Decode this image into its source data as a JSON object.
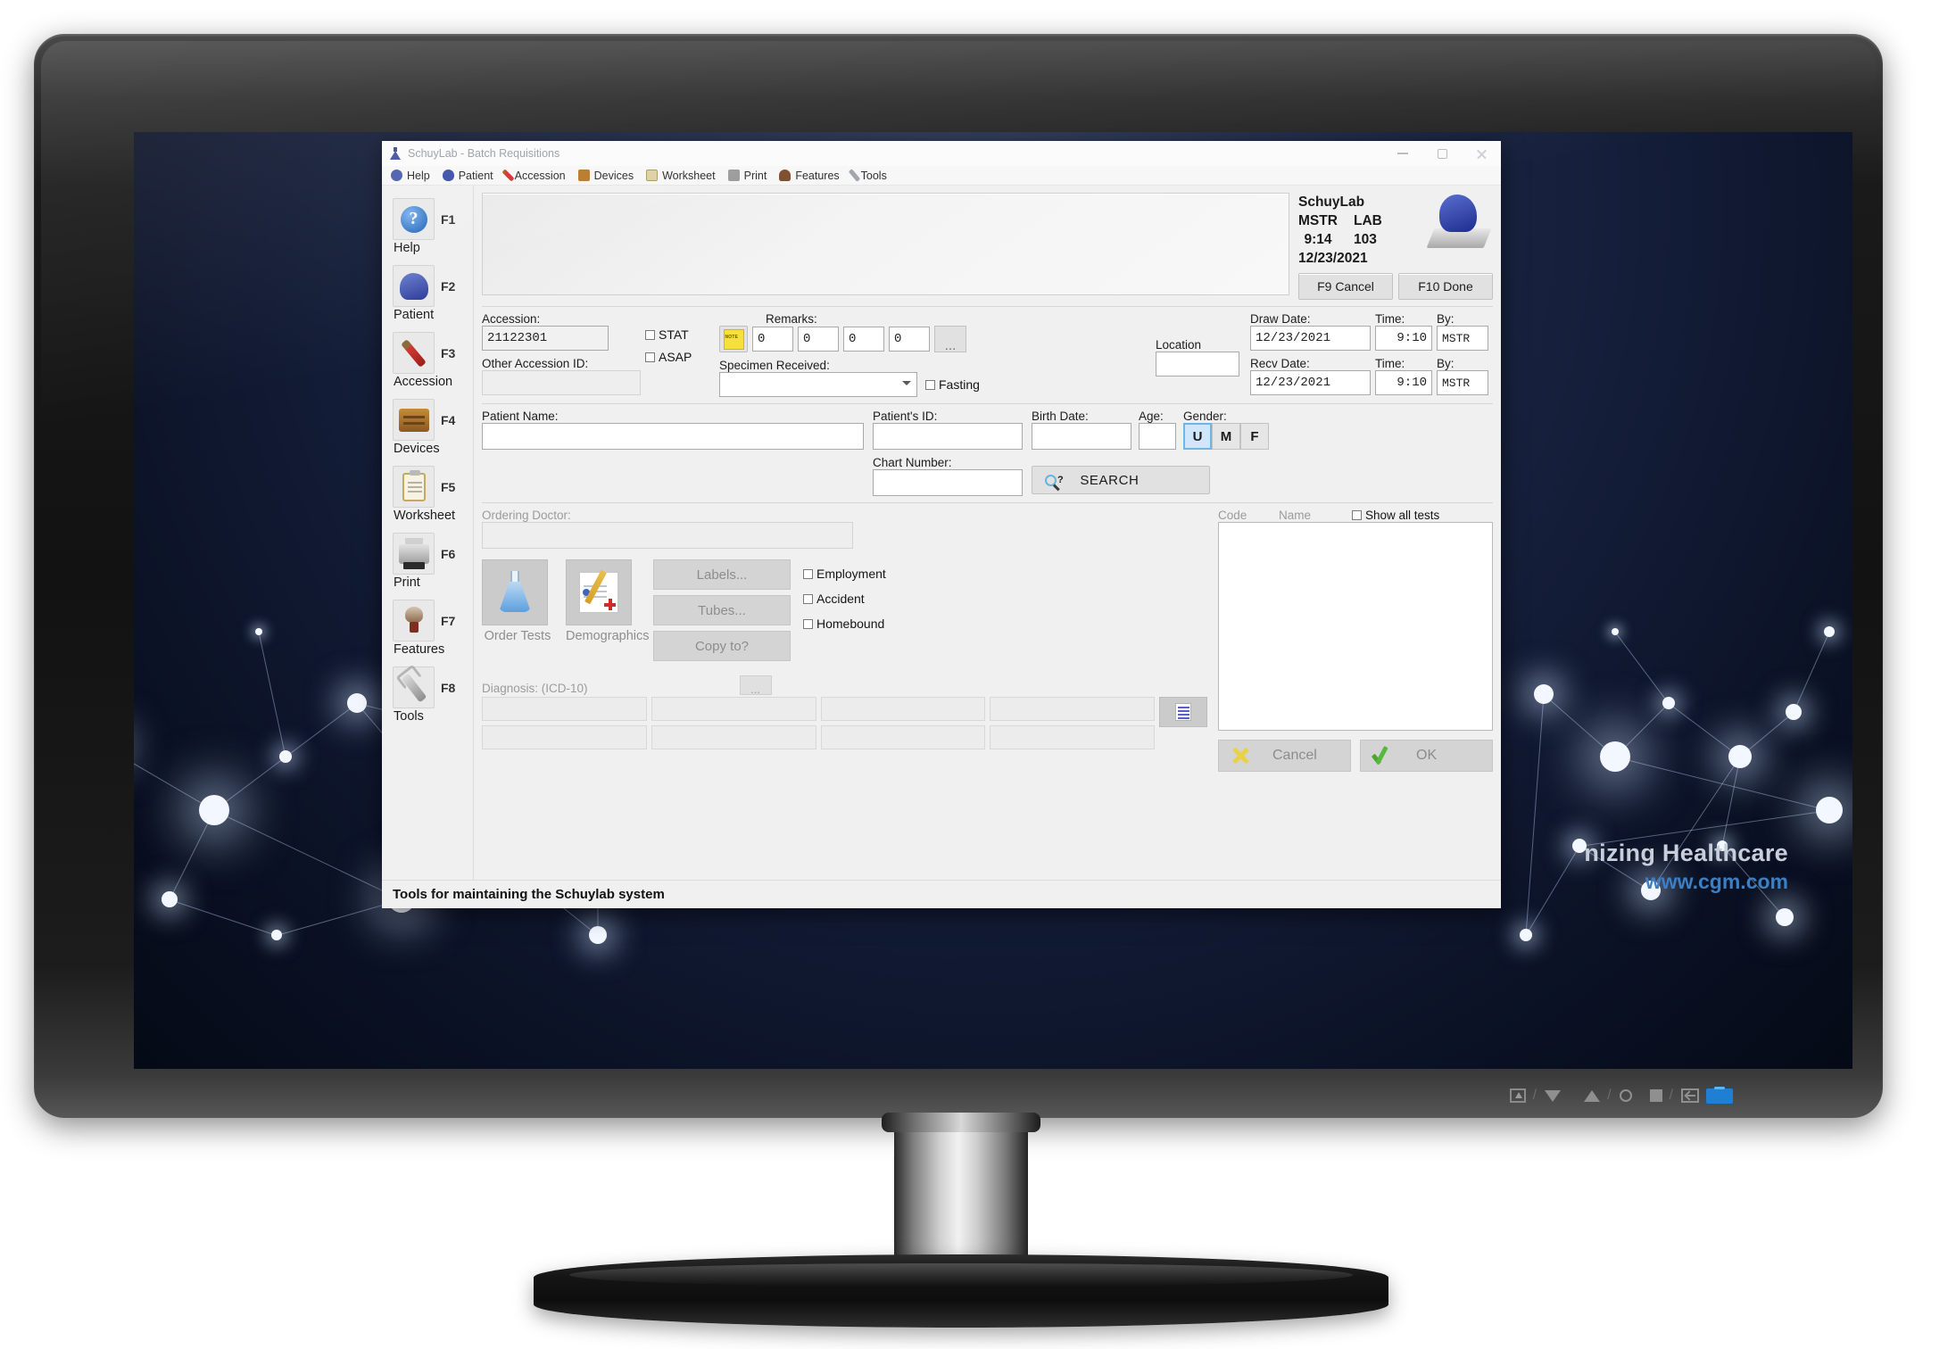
{
  "window": {
    "title": "SchuyLab - Batch Requisitions",
    "titlebar_icon": "flask-icon",
    "minimize": "minimize-icon",
    "maximize": "maximize-icon",
    "close": "close-icon"
  },
  "menubar": [
    {
      "label": "Help",
      "icon": "help-icon"
    },
    {
      "label": "Patient",
      "icon": "patient-head-icon"
    },
    {
      "label": "Accession",
      "icon": "test-tube-icon"
    },
    {
      "label": "Devices",
      "icon": "devices-icon"
    },
    {
      "label": "Worksheet",
      "icon": "clipboard-icon"
    },
    {
      "label": "Print",
      "icon": "printer-icon"
    },
    {
      "label": "Features",
      "icon": "features-icon"
    },
    {
      "label": "Tools",
      "icon": "wrench-icon"
    }
  ],
  "sidebar": [
    {
      "key": "F1",
      "label": "Help",
      "icon": "help-icon"
    },
    {
      "key": "F2",
      "label": "Patient",
      "icon": "patient-head-icon"
    },
    {
      "key": "F3",
      "label": "Accession",
      "icon": "test-tube-icon"
    },
    {
      "key": "F4",
      "label": "Devices",
      "icon": "devices-icon"
    },
    {
      "key": "F5",
      "label": "Worksheet",
      "icon": "clipboard-icon"
    },
    {
      "key": "F6",
      "label": "Print",
      "icon": "printer-icon"
    },
    {
      "key": "F7",
      "label": "Features",
      "icon": "features-icon"
    },
    {
      "key": "F8",
      "label": "Tools",
      "icon": "wrench-icon"
    }
  ],
  "brand": {
    "name": "SchuyLab",
    "user": "MSTR",
    "site": "LAB",
    "time": "9:14",
    "station": "103",
    "date": "12/23/2021",
    "logo_icon": "schuylab-head-logo-icon",
    "cancel_button": "F9 Cancel",
    "done_button": "F10 Done"
  },
  "accession": {
    "label": "Accession:",
    "value": "21122301",
    "stat_label": "STAT",
    "stat_checked": false,
    "asap_label": "ASAP",
    "asap_checked": false,
    "other_id_label": "Other Accession ID:",
    "other_id_value": "",
    "remarks_label": "Remarks:",
    "note_icon": "sticky-note-icon",
    "remarks_values": [
      "0",
      "0",
      "0",
      "0"
    ],
    "remarks_more": "...",
    "specimen_label": "Specimen Received:",
    "specimen_value": "",
    "fasting_label": "Fasting",
    "fasting_checked": false,
    "location_label": "Location",
    "location_value": ""
  },
  "dates": {
    "draw_date_label": "Draw Date:",
    "draw_date": "12/23/2021",
    "draw_time_label": "Time:",
    "draw_time": "9:10",
    "draw_by_label": "By:",
    "draw_by": "MSTR",
    "recv_date_label": "Recv Date:",
    "recv_date": "12/23/2021",
    "recv_time_label": "Time:",
    "recv_time": "9:10",
    "recv_by_label": "By:",
    "recv_by": "MSTR"
  },
  "patient": {
    "name_label": "Patient Name:",
    "name_value": "",
    "id_label": "Patient's ID:",
    "id_value": "",
    "chart_label": "Chart Number:",
    "chart_value": "",
    "birth_label": "Birth Date:",
    "birth_value": "",
    "age_label": "Age:",
    "age_value": "",
    "gender_label": "Gender:",
    "gender_options": [
      "U",
      "M",
      "F"
    ],
    "gender_selected": "U",
    "search_label": "SEARCH",
    "search_icon": "search-icon"
  },
  "orders": {
    "doctor_label": "Ordering Doctor:",
    "doctor_value": "",
    "order_tests_label": "Order Tests",
    "order_tests_icon": "flask-icon",
    "demographics_label": "Demographics",
    "demographics_icon": "demographics-icon",
    "labels_button": "Labels...",
    "tubes_button": "Tubes...",
    "copy_to_button": "Copy to?",
    "checkboxes": [
      {
        "label": "Employment",
        "checked": false
      },
      {
        "label": "Accident",
        "checked": false
      },
      {
        "label": "Homebound",
        "checked": false
      }
    ]
  },
  "diagnosis": {
    "label": "Diagnosis: (ICD-10)",
    "more_button": "...",
    "list_icon": "list-icon",
    "row1": [
      "",
      "",
      "",
      ""
    ],
    "row2": [
      "",
      "",
      "",
      ""
    ]
  },
  "tests": {
    "code_header": "Code",
    "name_header": "Name",
    "show_all_label": "Show all tests",
    "show_all_checked": false,
    "rows": [],
    "cancel_button": "Cancel",
    "cancel_icon": "x-icon",
    "ok_button": "OK",
    "ok_icon": "check-icon"
  },
  "statusbar": {
    "text": "Tools for maintaining the Schuylab system"
  },
  "wallpaper": {
    "watermark_line1": "nizing Healthcare",
    "watermark_line2": "www.cgm.com"
  },
  "monitor": {
    "osd_icons": [
      "input-icon",
      "down-icon",
      "up-icon",
      "brightness-icon",
      "menu-icon",
      "back-icon",
      "power-icon"
    ]
  }
}
